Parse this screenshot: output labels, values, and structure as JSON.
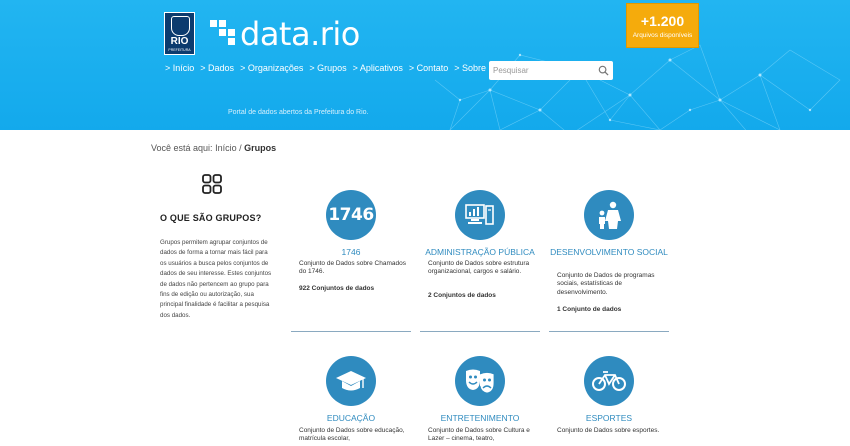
{
  "header": {
    "logo_text": "RIO",
    "logo_subtext": "PREFEITURA",
    "brand": "data.rio",
    "tagline": "Portal de dados abertos da Prefeitura do Rio.",
    "search_placeholder": "Pesquisar",
    "badge": {
      "count": "+1.200",
      "label": "Arquivos disponíveis"
    },
    "nav": [
      {
        "label": "> Início"
      },
      {
        "label": "> Dados"
      },
      {
        "label": "> Organizações"
      },
      {
        "label": "> Grupos"
      },
      {
        "label": "> Aplicativos"
      },
      {
        "label": "> Contato"
      },
      {
        "label": "> Sobre"
      }
    ]
  },
  "breadcrumb": {
    "prefix": "Você está aqui:",
    "home": "Início",
    "separator": "/",
    "current": "Grupos"
  },
  "sidebar": {
    "title": "O QUE SÃO GRUPOS?",
    "text": "Grupos permitem agrupar conjuntos de dados de forma a tornar mais fácil para os usuários a busca pelos  conjuntos de dados de seu  interesse. Estes conjuntos de dados  não pertencem ao grupo para fins de edição ou autorização, sua principal finalidade é facilitar a pesquisa dos dados."
  },
  "groups": [
    {
      "icon": "1746-icon",
      "icon_text": "1746",
      "title": "1746",
      "desc": "Conjunto de Dados sobre Chamados do 1746.",
      "count": "922 Conjuntos de dados"
    },
    {
      "icon": "computer-chart-icon",
      "title": "ADMINISTRAÇÃO PÚBLICA",
      "desc": "Conjunto de Dados sobre estrutura organizacional, cargos e salário.",
      "count": "2 Conjuntos de dados"
    },
    {
      "icon": "people-icon",
      "title": "DESENVOLVIMENTO SOCIAL",
      "desc": "Conjunto de Dados de programas sociais, estatísticas de desenvolvimento.",
      "count": "1 Conjunto de dados"
    },
    {
      "icon": "graduation-cap-icon",
      "title": "EDUCAÇÃO",
      "desc": "Conjunto de Dados sobre educação, matrícula escolar,",
      "count": ""
    },
    {
      "icon": "theater-masks-icon",
      "title": "ENTRETENIMENTO",
      "desc": "Conjunto de Dados sobre Cultura e Lazer – cinema, teatro,",
      "count": ""
    },
    {
      "icon": "bicycle-icon",
      "title": "ESPORTES",
      "desc": "Conjunto de Dados sobre esportes.",
      "count": ""
    }
  ],
  "colors": {
    "header": "#18adee",
    "accent": "#2f8bbf",
    "badge": "#f5ab0c"
  }
}
